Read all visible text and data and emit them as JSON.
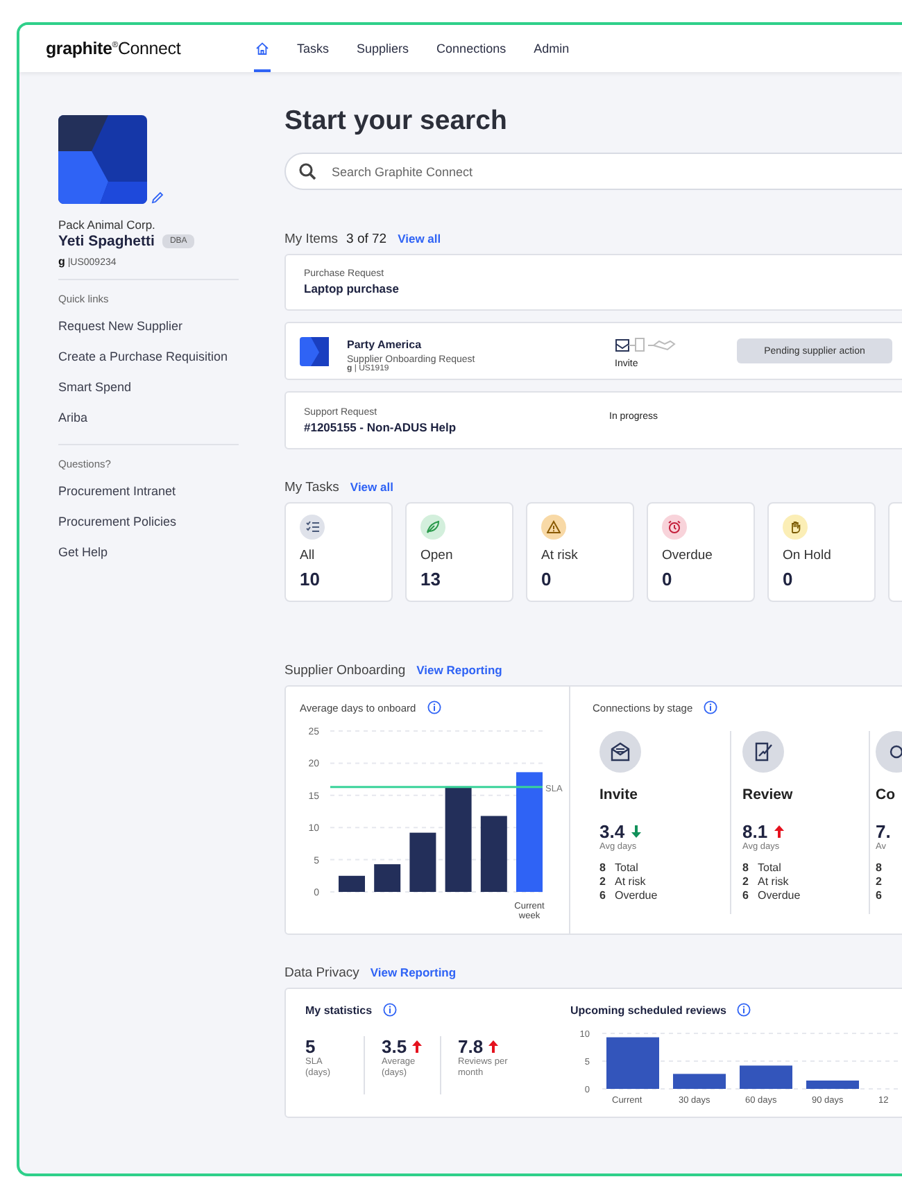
{
  "logo": {
    "brand": "graphite",
    "mark": "®",
    "product": "Connect"
  },
  "nav": [
    {
      "kind": "home",
      "selected": true
    },
    {
      "kind": "text",
      "label": "Tasks",
      "selected": false
    },
    {
      "kind": "text",
      "label": "Suppliers",
      "selected": false
    },
    {
      "kind": "text",
      "label": "Connections",
      "selected": false
    },
    {
      "kind": "text",
      "label": "Admin",
      "selected": false
    }
  ],
  "profile": {
    "company": "Pack Animal Corp.",
    "name": "Yeti Spaghetti",
    "badge": "DBA",
    "logo_letter": "g",
    "id": "|US009234"
  },
  "sidebar": [
    {
      "heading": "Quick links",
      "links": [
        "Request New Supplier",
        "Create a Purchase Requisition",
        "Smart Spend",
        "Ariba"
      ]
    },
    {
      "heading": "Questions?",
      "links": [
        "Procurement Intranet",
        "Procurement Policies",
        "Get Help"
      ]
    }
  ],
  "title": "Start your search",
  "search": {
    "placeholder": "Search Graphite Connect"
  },
  "my_items": {
    "title": "My Items",
    "count": "3 of 72",
    "link": "View all",
    "items": [
      {
        "kind": "request",
        "type": "Purchase Request",
        "name": "Laptop purchase"
      },
      {
        "kind": "onboarding",
        "name": "Party America",
        "type": "Supplier Onboarding Request",
        "logo_letter": "g",
        "id": "| US1919",
        "stage": "Invite",
        "status": "Pending supplier action"
      },
      {
        "kind": "support",
        "type": "Support Request",
        "name": "#1205155 - Non-ADUS Help",
        "status": "In progress"
      }
    ]
  },
  "my_tasks": {
    "title": "My Tasks",
    "link": "View all",
    "tasks": [
      {
        "kind": "list",
        "label": "All",
        "count": "10",
        "color": "#dfe2ea"
      },
      {
        "kind": "leaf",
        "label": "Open",
        "count": "13",
        "color": "#d3efdc"
      },
      {
        "kind": "warning",
        "label": "At risk",
        "count": "0",
        "color": "#f8d9a6"
      },
      {
        "kind": "alarm",
        "label": "Overdue",
        "count": "0",
        "color": "#f8d3da"
      },
      {
        "kind": "hand",
        "label": "On Hold",
        "count": "0",
        "color": "#fbeeb6"
      }
    ]
  },
  "supplier_onboarding": {
    "title": "Supplier Onboarding",
    "link": "View Reporting",
    "days_chart": {
      "title": "Average days to onboard",
      "chart_data": {
        "type": "bar",
        "categories": [
          null,
          null,
          null,
          null,
          null,
          "Current week"
        ],
        "yticks": [
          0,
          5,
          10,
          15,
          20,
          25
        ],
        "ylim": [
          0,
          25
        ],
        "grid": true,
        "series": [
          {
            "values": [
              2.5,
              4.3,
              9.2,
              16.4,
              11.8,
              18.6
            ]
          }
        ],
        "ref_lines": [
          {
            "axis": "y",
            "value": 16.3,
            "label": "SLA"
          }
        ]
      }
    },
    "stages": {
      "title": "Connections by stage",
      "items": [
        {
          "kind": "invite",
          "name": "Invite",
          "value": "3.4",
          "trend_up": false,
          "label": "Avg days",
          "stats": [
            {
              "count": "8",
              "label": "Total"
            },
            {
              "count": "2",
              "label": "At risk"
            },
            {
              "count": "6",
              "label": "Overdue"
            }
          ]
        },
        {
          "kind": "review",
          "name": "Review",
          "value": "8.1",
          "trend_up": true,
          "label": "Avg days",
          "stats": [
            {
              "count": "8",
              "label": "Total"
            },
            {
              "count": "2",
              "label": "At risk"
            },
            {
              "count": "6",
              "label": "Overdue"
            }
          ]
        },
        {
          "kind": "other",
          "name": "Co",
          "value": "7.",
          "label": "Av",
          "stats": [
            {
              "count": "8"
            },
            {
              "count": "2"
            },
            {
              "count": "6"
            }
          ]
        }
      ]
    }
  },
  "data_privacy": {
    "title": "Data Privacy",
    "link": "View Reporting",
    "statistics": {
      "title": "My statistics",
      "items": [
        {
          "value": "5",
          "label": "SLA (days)"
        },
        {
          "value": "3.5",
          "trend_up": true,
          "label": "Average (days)"
        },
        {
          "value": "7.8",
          "trend_up": true,
          "label": "Reviews per month"
        }
      ]
    },
    "reviews_chart": {
      "title": "Upcoming scheduled reviews",
      "chart_data": {
        "type": "bar",
        "categories": [
          "Current",
          "30 days",
          "60 days",
          "90 days",
          "12"
        ],
        "yticks": [
          0,
          5,
          10
        ],
        "ylim": [
          0,
          10
        ],
        "grid": true,
        "series": [
          {
            "values": [
              9.3,
              2.7,
              4.2,
              1.5,
              null
            ]
          }
        ]
      }
    }
  }
}
